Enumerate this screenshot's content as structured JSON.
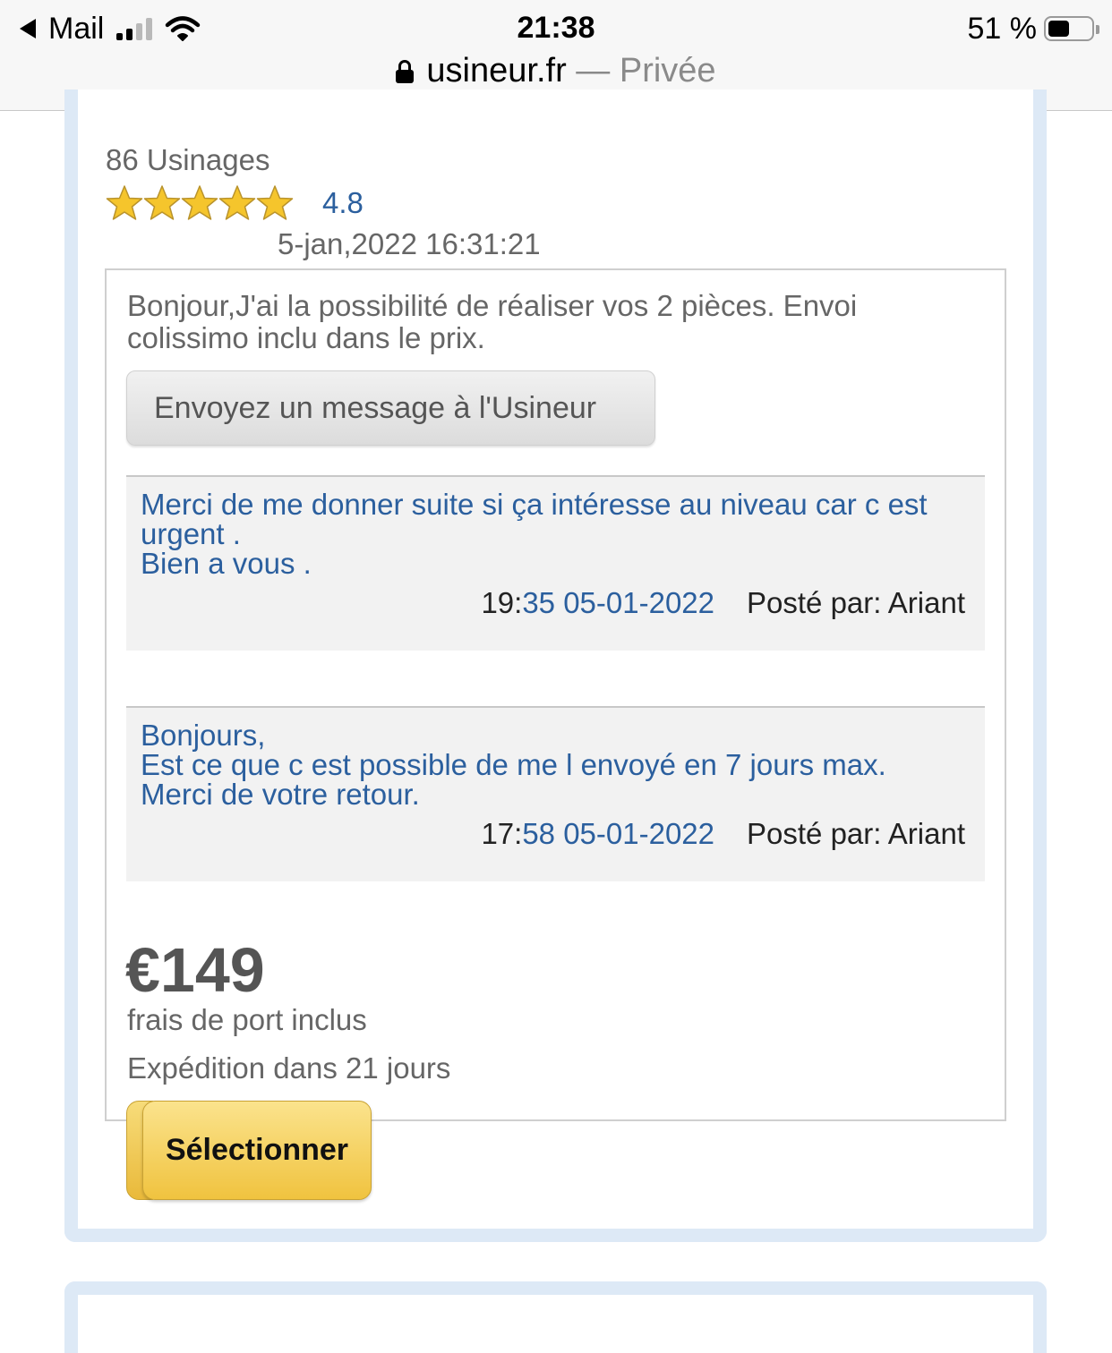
{
  "status_bar": {
    "back_app": "Mail",
    "time": "21:38",
    "battery_percent": "51 %",
    "battery_level": 0.51
  },
  "url_bar": {
    "domain": "usineur.fr",
    "mode": "— Privée"
  },
  "offer": {
    "usinages_count": "86 Usinages",
    "rating_value": "4.8",
    "stars_filled": 5,
    "date": "5-jan,2022 16:31:21",
    "message": "Bonjour,J'ai la possibilité de réaliser vos 2 pièces. Envoi colissimo inclu dans le prix.",
    "message_button_label": "Envoyez un message à l'Usineur",
    "comments": [
      {
        "lines": [
          "Merci de me donner suite si ça intéresse au niveau car c est urgent .",
          "Bien a vous ."
        ],
        "time_hour": "19:",
        "time_rest": "35 05-01-2022",
        "posted_by": "Posté par: Ariant"
      },
      {
        "lines": [
          "Bonjours,",
          "Est ce que c est possible de me l envoyé en 7 jours max.",
          "Merci de votre retour."
        ],
        "time_hour": "17:",
        "time_rest": "58 05-01-2022",
        "posted_by": "Posté par: Ariant"
      }
    ],
    "price": "€149",
    "shipping_note": "frais de port inclus",
    "delay": "Expédition dans 21 jours",
    "select_label": "Sélectionner"
  },
  "colors": {
    "link_blue": "#2b5f9e",
    "frame_blue": "#dde9f6",
    "star_gold": "#f5c52c",
    "select_yellow": "#f0c33f"
  },
  "icons": [
    "back-arrow-icon",
    "signal-icon",
    "wifi-icon",
    "lock-icon",
    "battery-icon",
    "star-icon"
  ]
}
